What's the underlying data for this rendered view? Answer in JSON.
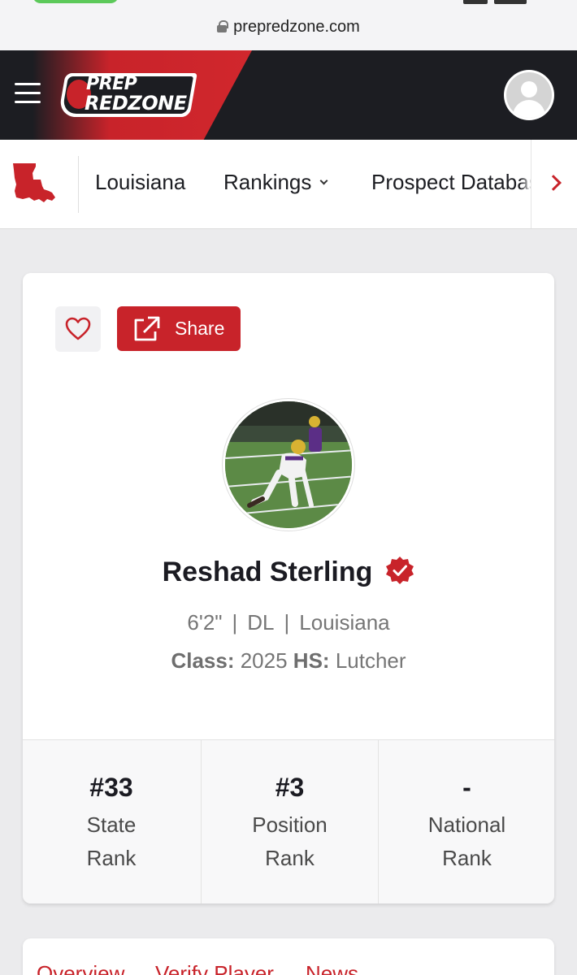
{
  "browser": {
    "url": "prepredzone.com"
  },
  "header": {
    "logo_line1": "PREP",
    "logo_line2": "REDZONE",
    "accent_color": "#c8232a",
    "background_color": "#1c1d22"
  },
  "subnav": {
    "items": [
      {
        "label": "Louisiana"
      },
      {
        "label": "Rankings",
        "has_dropdown": true
      },
      {
        "label": "Prospect Database"
      }
    ]
  },
  "profile": {
    "share_label": "Share",
    "name": "Reshad Sterling",
    "verified": true,
    "height": "6'2\"",
    "position": "DL",
    "state": "Louisiana",
    "separator": "|",
    "class_label": "Class:",
    "class_value": "2025",
    "hs_label": "HS:",
    "hs_value": "Lutcher"
  },
  "ranks": [
    {
      "value": "#33",
      "label_line1": "State",
      "label_line2": "Rank"
    },
    {
      "value": "#3",
      "label_line1": "Position",
      "label_line2": "Rank"
    },
    {
      "value": "-",
      "label_line1": "National",
      "label_line2": "Rank"
    }
  ],
  "tabs": [
    {
      "label": "Overview"
    },
    {
      "label": "Verify Player"
    },
    {
      "label": "News"
    }
  ],
  "icons": [
    "lock-icon",
    "hamburger-menu-icon",
    "user-avatar-icon",
    "louisiana-state-icon",
    "chevron-down-icon",
    "chevron-right-icon",
    "heart-icon",
    "external-link-icon",
    "verified-check-icon"
  ]
}
